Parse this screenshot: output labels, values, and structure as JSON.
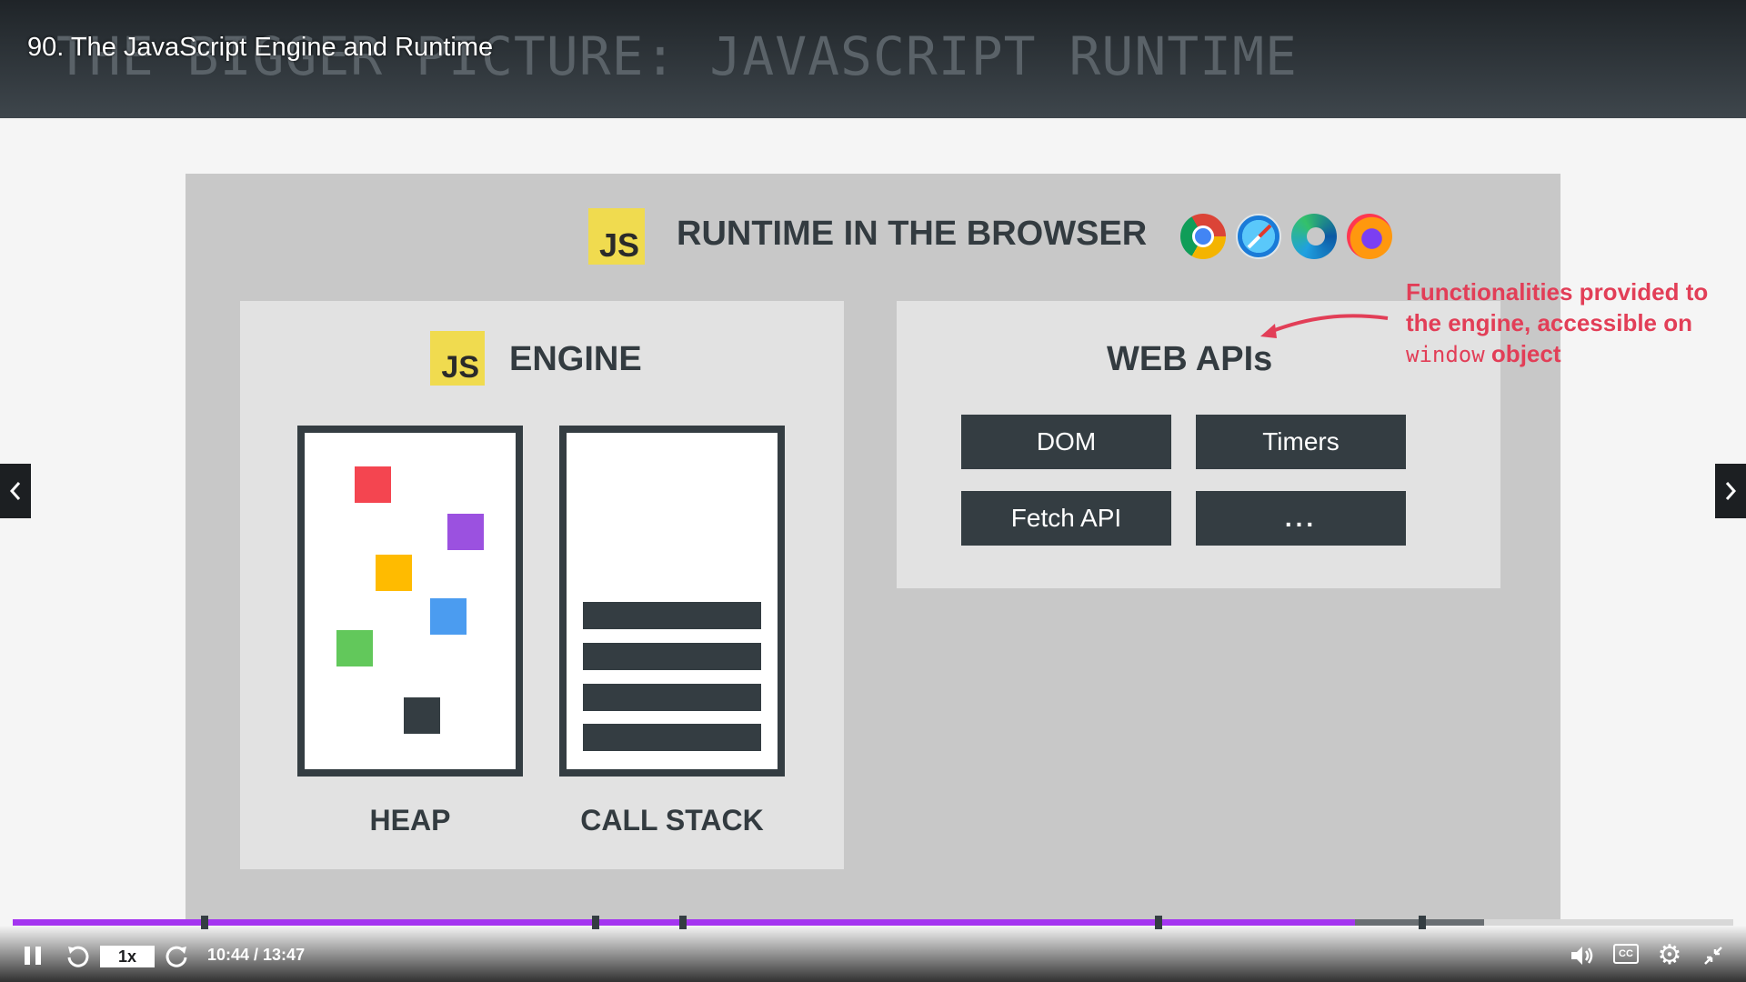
{
  "header": {
    "lecture_title": "90. The JavaScript Engine and Runtime",
    "background_title": "THE BIGGER PICTURE: JAVASCRIPT RUNTIME"
  },
  "slide": {
    "js_logo_text": "JS",
    "runtime_title": "RUNTIME IN THE BROWSER",
    "browser_icons": [
      "chrome-icon",
      "safari-icon",
      "edge-icon",
      "firefox-icon"
    ],
    "engine": {
      "title": "ENGINE",
      "heap_label": "HEAP",
      "callstack_label": "CALL STACK",
      "heap_object_colors": [
        "#f44550",
        "#9b51e0",
        "#ffbb00",
        "#4b9cf0",
        "#62c85b",
        "#343d42"
      ]
    },
    "web_apis": {
      "title": "WEB APIs",
      "items": [
        "DOM",
        "Timers",
        "Fetch API",
        "..."
      ]
    },
    "annotation": {
      "line1": "Functionalities provided to",
      "line2": "the engine, accessible on",
      "code": "window",
      "tail": " object"
    }
  },
  "player": {
    "speed": "1x",
    "time": "10:44 / 13:47",
    "progress_fraction": 0.78,
    "buffered_fraction": 0.855,
    "accent_color": "#a435f0"
  }
}
